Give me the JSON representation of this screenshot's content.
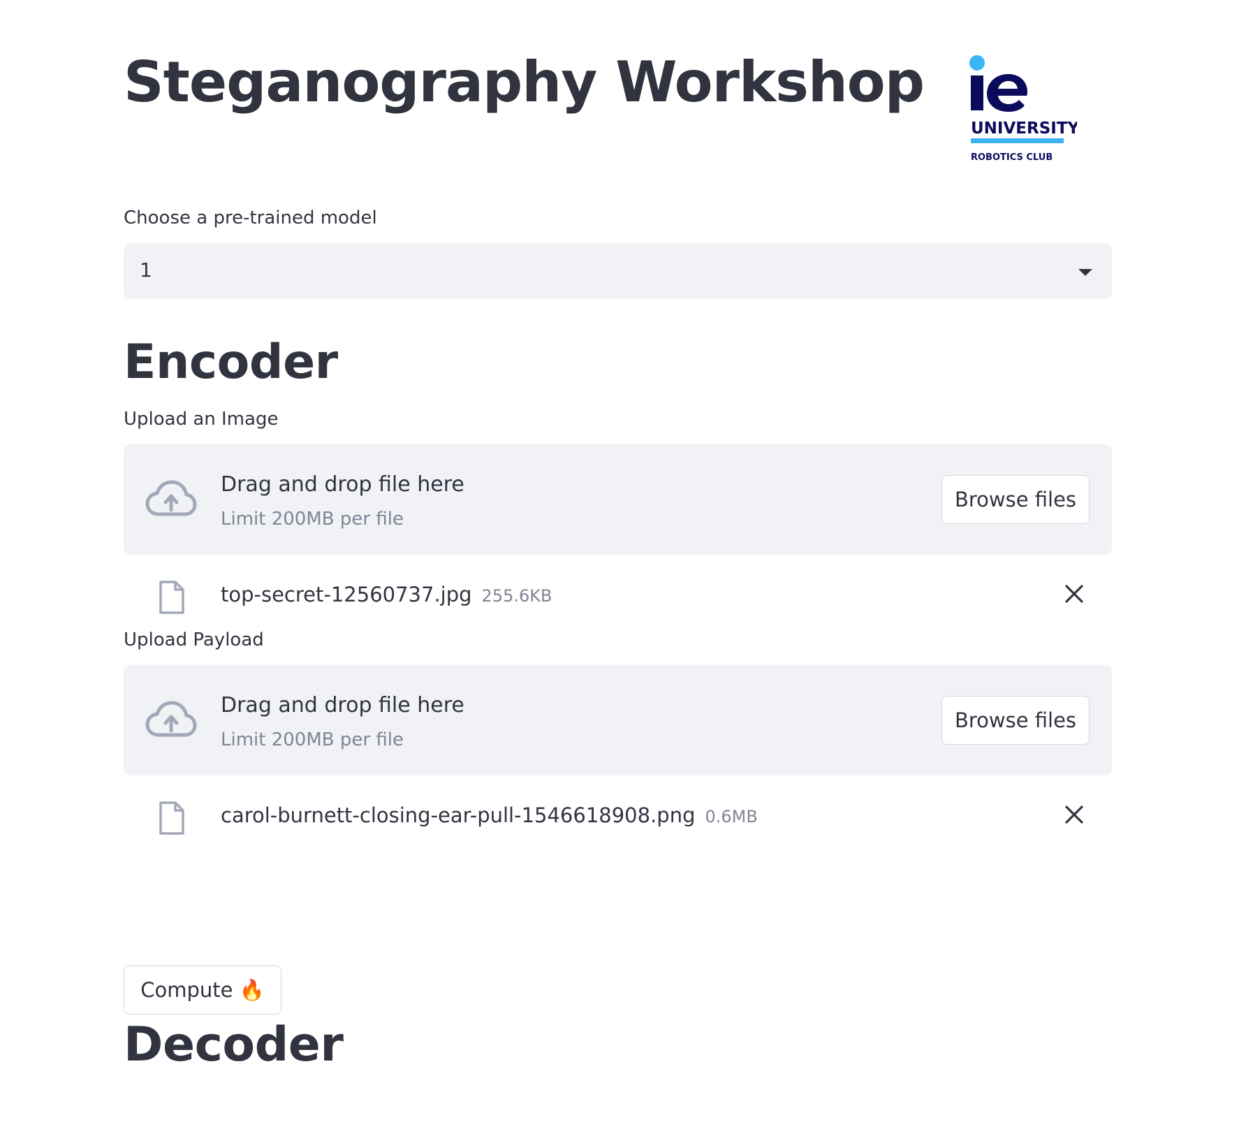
{
  "page_title": "Steganography Workshop",
  "logo": {
    "mark": "ie",
    "line1": "UNIVERSITY",
    "line2": "ROBOTICS CLUB",
    "colors": {
      "navy": "#0b0b5c",
      "accent": "#3ab4f2"
    }
  },
  "model_select": {
    "label": "Choose a pre-trained model",
    "value": "1"
  },
  "encoder": {
    "title": "Encoder",
    "image_upload": {
      "label": "Upload an Image",
      "dropzone_text": "Drag and drop file here",
      "dropzone_limit": "Limit 200MB per file",
      "browse_label": "Browse files",
      "file": {
        "name": "top-secret-12560737.jpg",
        "size": "255.6KB"
      }
    },
    "payload_upload": {
      "label": "Upload Payload",
      "dropzone_text": "Drag and drop file here",
      "dropzone_limit": "Limit 200MB per file",
      "browse_label": "Browse files",
      "file": {
        "name": "carol-burnett-closing-ear-pull-1546618908.png",
        "size": "0.6MB"
      }
    },
    "compute_label": "Compute 🔥"
  },
  "decoder": {
    "title": "Decoder"
  }
}
